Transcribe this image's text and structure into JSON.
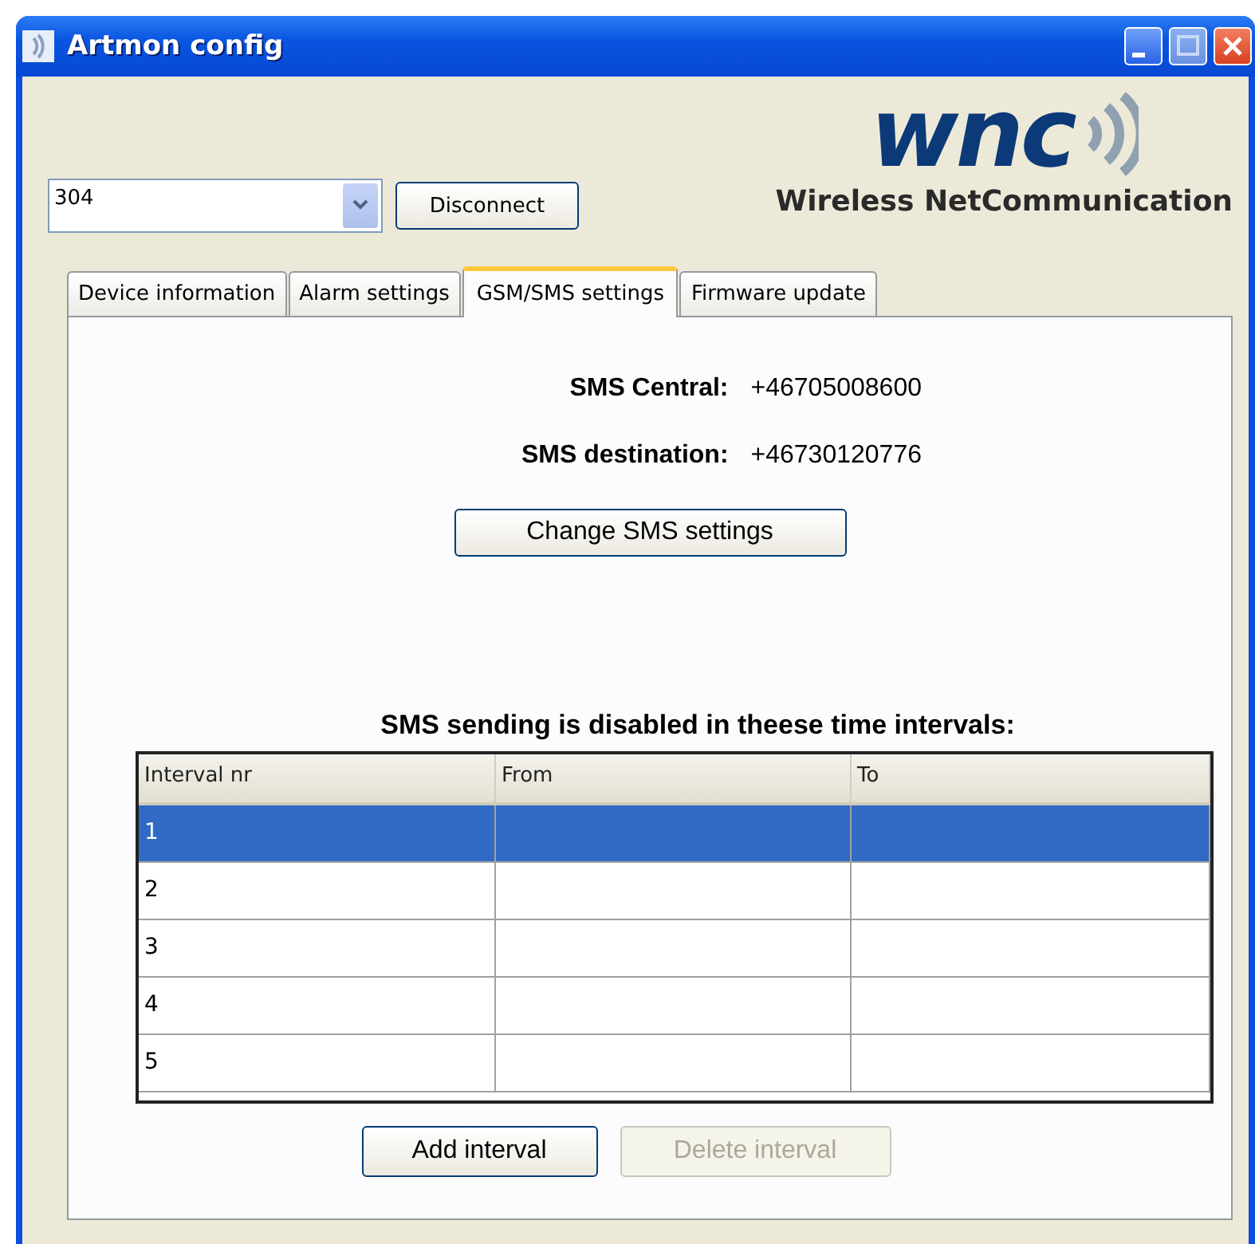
{
  "window": {
    "title": "Artmon config"
  },
  "device": {
    "value": "304"
  },
  "connect_button": {
    "label": "Disconnect"
  },
  "logo": {
    "mark": "wnc",
    "tagline": "Wireless NetCommunication"
  },
  "tabs": [
    {
      "label": "Device information",
      "selected": false
    },
    {
      "label": "Alarm settings",
      "selected": false
    },
    {
      "label": "GSM/SMS settings",
      "selected": true
    },
    {
      "label": "Firmware update",
      "selected": false
    }
  ],
  "sms": [
    {
      "label": "SMS Central:",
      "value": "+46705008600"
    },
    {
      "label": "SMS destination:",
      "value": "+46730120776"
    }
  ],
  "change_button": {
    "label": "Change SMS settings"
  },
  "intervals_heading": "SMS sending is disabled in theese time intervals:",
  "table": {
    "columns": [
      "Interval nr",
      "From",
      "To"
    ],
    "rows": [
      {
        "cells": [
          "1",
          "",
          ""
        ],
        "selected": true
      },
      {
        "cells": [
          "2",
          "",
          ""
        ],
        "selected": false
      },
      {
        "cells": [
          "3",
          "",
          ""
        ],
        "selected": false
      },
      {
        "cells": [
          "4",
          "",
          ""
        ],
        "selected": false
      },
      {
        "cells": [
          "5",
          "",
          ""
        ],
        "selected": false
      }
    ]
  },
  "buttons": [
    {
      "label": "Add interval",
      "disabled": false
    },
    {
      "label": "Delete interval",
      "disabled": true
    }
  ]
}
